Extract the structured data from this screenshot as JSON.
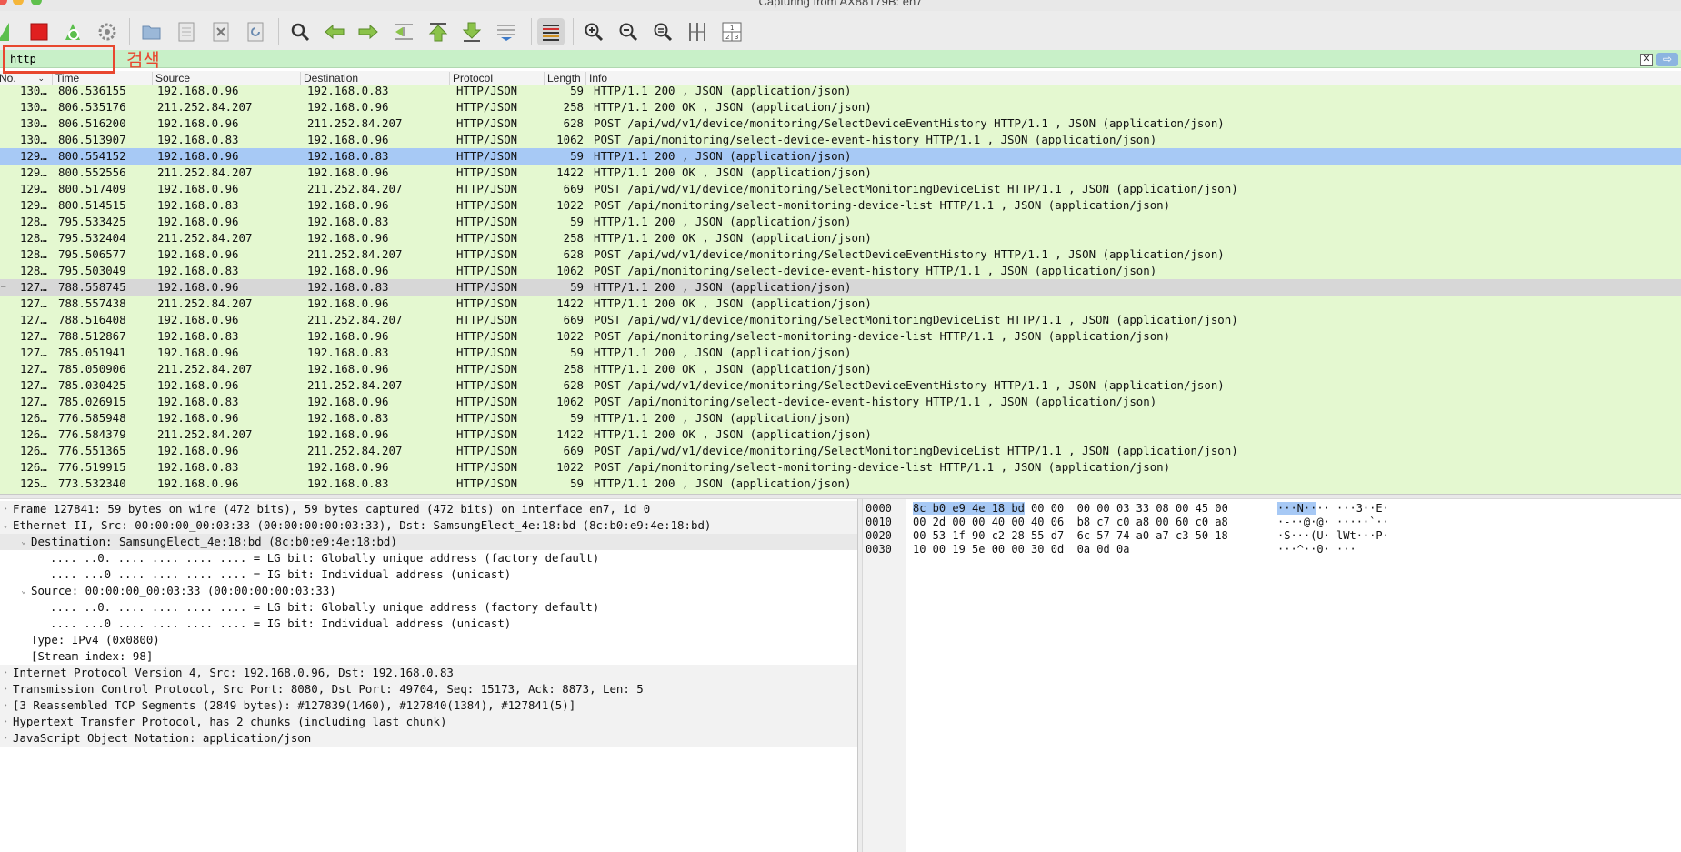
{
  "window": {
    "title": "Capturing from AX88179B: en7"
  },
  "filter": {
    "value": "http",
    "annotation": "검색"
  },
  "columns": [
    "No.",
    "Time",
    "Source",
    "Destination",
    "Protocol",
    "Length",
    "Info"
  ],
  "packets": [
    {
      "no": "130…",
      "time": "806.536155",
      "src": "192.168.0.96",
      "dst": "192.168.0.83",
      "proto": "HTTP/JSON",
      "len": "59",
      "info": "HTTP/1.1 200  , JSON (application/json)",
      "state": "normal"
    },
    {
      "no": "130…",
      "time": "806.535176",
      "src": "211.252.84.207",
      "dst": "192.168.0.96",
      "proto": "HTTP/JSON",
      "len": "258",
      "info": "HTTP/1.1 200 OK , JSON (application/json)",
      "state": "normal"
    },
    {
      "no": "130…",
      "time": "806.516200",
      "src": "192.168.0.96",
      "dst": "211.252.84.207",
      "proto": "HTTP/JSON",
      "len": "628",
      "info": "POST /api/wd/v1/device/monitoring/SelectDeviceEventHistory HTTP/1.1 , JSON (application/json)",
      "state": "normal"
    },
    {
      "no": "130…",
      "time": "806.513907",
      "src": "192.168.0.83",
      "dst": "192.168.0.96",
      "proto": "HTTP/JSON",
      "len": "1062",
      "info": "POST /api/monitoring/select-device-event-history HTTP/1.1 , JSON (application/json)",
      "state": "normal"
    },
    {
      "no": "129…",
      "time": "800.554152",
      "src": "192.168.0.96",
      "dst": "192.168.0.83",
      "proto": "HTTP/JSON",
      "len": "59",
      "info": "HTTP/1.1 200  , JSON (application/json)",
      "state": "selected"
    },
    {
      "no": "129…",
      "time": "800.552556",
      "src": "211.252.84.207",
      "dst": "192.168.0.96",
      "proto": "HTTP/JSON",
      "len": "1422",
      "info": "HTTP/1.1 200 OK , JSON (application/json)",
      "state": "normal"
    },
    {
      "no": "129…",
      "time": "800.517409",
      "src": "192.168.0.96",
      "dst": "211.252.84.207",
      "proto": "HTTP/JSON",
      "len": "669",
      "info": "POST /api/wd/v1/device/monitoring/SelectMonitoringDeviceList HTTP/1.1 , JSON (application/json)",
      "state": "normal"
    },
    {
      "no": "129…",
      "time": "800.514515",
      "src": "192.168.0.83",
      "dst": "192.168.0.96",
      "proto": "HTTP/JSON",
      "len": "1022",
      "info": "POST /api/monitoring/select-monitoring-device-list HTTP/1.1 , JSON (application/json)",
      "state": "normal"
    },
    {
      "no": "128…",
      "time": "795.533425",
      "src": "192.168.0.96",
      "dst": "192.168.0.83",
      "proto": "HTTP/JSON",
      "len": "59",
      "info": "HTTP/1.1 200  , JSON (application/json)",
      "state": "normal"
    },
    {
      "no": "128…",
      "time": "795.532404",
      "src": "211.252.84.207",
      "dst": "192.168.0.96",
      "proto": "HTTP/JSON",
      "len": "258",
      "info": "HTTP/1.1 200 OK , JSON (application/json)",
      "state": "normal"
    },
    {
      "no": "128…",
      "time": "795.506577",
      "src": "192.168.0.96",
      "dst": "211.252.84.207",
      "proto": "HTTP/JSON",
      "len": "628",
      "info": "POST /api/wd/v1/device/monitoring/SelectDeviceEventHistory HTTP/1.1 , JSON (application/json)",
      "state": "normal"
    },
    {
      "no": "128…",
      "time": "795.503049",
      "src": "192.168.0.83",
      "dst": "192.168.0.96",
      "proto": "HTTP/JSON",
      "len": "1062",
      "info": "POST /api/monitoring/select-device-event-history HTTP/1.1 , JSON (application/json)",
      "state": "normal"
    },
    {
      "no": "127…",
      "time": "788.558745",
      "src": "192.168.0.96",
      "dst": "192.168.0.83",
      "proto": "HTTP/JSON",
      "len": "59",
      "info": "HTTP/1.1 200  , JSON (application/json)",
      "state": "gray"
    },
    {
      "no": "127…",
      "time": "788.557438",
      "src": "211.252.84.207",
      "dst": "192.168.0.96",
      "proto": "HTTP/JSON",
      "len": "1422",
      "info": "HTTP/1.1 200 OK , JSON (application/json)",
      "state": "normal"
    },
    {
      "no": "127…",
      "time": "788.516408",
      "src": "192.168.0.96",
      "dst": "211.252.84.207",
      "proto": "HTTP/JSON",
      "len": "669",
      "info": "POST /api/wd/v1/device/monitoring/SelectMonitoringDeviceList HTTP/1.1 , JSON (application/json)",
      "state": "normal"
    },
    {
      "no": "127…",
      "time": "788.512867",
      "src": "192.168.0.83",
      "dst": "192.168.0.96",
      "proto": "HTTP/JSON",
      "len": "1022",
      "info": "POST /api/monitoring/select-monitoring-device-list HTTP/1.1 , JSON (application/json)",
      "state": "normal"
    },
    {
      "no": "127…",
      "time": "785.051941",
      "src": "192.168.0.96",
      "dst": "192.168.0.83",
      "proto": "HTTP/JSON",
      "len": "59",
      "info": "HTTP/1.1 200  , JSON (application/json)",
      "state": "normal"
    },
    {
      "no": "127…",
      "time": "785.050906",
      "src": "211.252.84.207",
      "dst": "192.168.0.96",
      "proto": "HTTP/JSON",
      "len": "258",
      "info": "HTTP/1.1 200 OK , JSON (application/json)",
      "state": "normal"
    },
    {
      "no": "127…",
      "time": "785.030425",
      "src": "192.168.0.96",
      "dst": "211.252.84.207",
      "proto": "HTTP/JSON",
      "len": "628",
      "info": "POST /api/wd/v1/device/monitoring/SelectDeviceEventHistory HTTP/1.1 , JSON (application/json)",
      "state": "normal"
    },
    {
      "no": "127…",
      "time": "785.026915",
      "src": "192.168.0.83",
      "dst": "192.168.0.96",
      "proto": "HTTP/JSON",
      "len": "1062",
      "info": "POST /api/monitoring/select-device-event-history HTTP/1.1 , JSON (application/json)",
      "state": "normal"
    },
    {
      "no": "126…",
      "time": "776.585948",
      "src": "192.168.0.96",
      "dst": "192.168.0.83",
      "proto": "HTTP/JSON",
      "len": "59",
      "info": "HTTP/1.1 200  , JSON (application/json)",
      "state": "normal"
    },
    {
      "no": "126…",
      "time": "776.584379",
      "src": "211.252.84.207",
      "dst": "192.168.0.96",
      "proto": "HTTP/JSON",
      "len": "1422",
      "info": "HTTP/1.1 200 OK , JSON (application/json)",
      "state": "normal"
    },
    {
      "no": "126…",
      "time": "776.551365",
      "src": "192.168.0.96",
      "dst": "211.252.84.207",
      "proto": "HTTP/JSON",
      "len": "669",
      "info": "POST /api/wd/v1/device/monitoring/SelectMonitoringDeviceList HTTP/1.1 , JSON (application/json)",
      "state": "normal"
    },
    {
      "no": "126…",
      "time": "776.519915",
      "src": "192.168.0.83",
      "dst": "192.168.0.96",
      "proto": "HTTP/JSON",
      "len": "1022",
      "info": "POST /api/monitoring/select-monitoring-device-list HTTP/1.1 , JSON (application/json)",
      "state": "normal"
    },
    {
      "no": "125…",
      "time": "773.532340",
      "src": "192.168.0.96",
      "dst": "192.168.0.83",
      "proto": "HTTP/JSON",
      "len": "59",
      "info": "HTTP/1.1 200  , JSON (application/json)",
      "state": "normal"
    }
  ],
  "details": [
    {
      "text": "Frame 127841: 59 bytes on wire (472 bits), 59 bytes captured (472 bits) on interface en7, id 0",
      "level": 0,
      "expander": "›",
      "style": "topl"
    },
    {
      "text": "Ethernet II, Src: 00:00:00_00:03:33 (00:00:00:00:03:33), Dst: SamsungElect_4e:18:bd (8c:b0:e9:4e:18:bd)",
      "level": 0,
      "expander": "⌄",
      "style": "topl"
    },
    {
      "text": "Destination: SamsungElect_4e:18:bd (8c:b0:e9:4e:18:bd)",
      "level": 1,
      "expander": "⌄",
      "style": "hl"
    },
    {
      "text": ".... ..0. .... .... .... .... = LG bit: Globally unique address (factory default)",
      "level": 2,
      "expander": "",
      "style": ""
    },
    {
      "text": ".... ...0 .... .... .... .... = IG bit: Individual address (unicast)",
      "level": 2,
      "expander": "",
      "style": ""
    },
    {
      "text": "Source: 00:00:00_00:03:33 (00:00:00:00:03:33)",
      "level": 1,
      "expander": "⌄",
      "style": ""
    },
    {
      "text": ".... ..0. .... .... .... .... = LG bit: Globally unique address (factory default)",
      "level": 2,
      "expander": "",
      "style": ""
    },
    {
      "text": ".... ...0 .... .... .... .... = IG bit: Individual address (unicast)",
      "level": 2,
      "expander": "",
      "style": ""
    },
    {
      "text": "Type: IPv4 (0x0800)",
      "level": 1,
      "expander": "",
      "style": ""
    },
    {
      "text": "[Stream index: 98]",
      "level": 1,
      "expander": "",
      "style": ""
    },
    {
      "text": "Internet Protocol Version 4, Src: 192.168.0.96, Dst: 192.168.0.83",
      "level": 0,
      "expander": "›",
      "style": "topl"
    },
    {
      "text": "Transmission Control Protocol, Src Port: 8080, Dst Port: 49704, Seq: 15173, Ack: 8873, Len: 5",
      "level": 0,
      "expander": "›",
      "style": "topl"
    },
    {
      "text": "[3 Reassembled TCP Segments (2849 bytes): #127839(1460), #127840(1384), #127841(5)]",
      "level": 0,
      "expander": "›",
      "style": "topl"
    },
    {
      "text": "Hypertext Transfer Protocol, has 2 chunks (including last chunk)",
      "level": 0,
      "expander": "›",
      "style": "topl"
    },
    {
      "text": "JavaScript Object Notation: application/json",
      "level": 0,
      "expander": "›",
      "style": "topl"
    }
  ],
  "bytes": [
    {
      "offset": "0000",
      "hex_sel": "8c b0 e9 4e 18 bd",
      "hex_rest": " 00 00  00 00 03 33 08 00 45 00",
      "ascii_sel": "···N··",
      "ascii_rest": "·· ···3··E·"
    },
    {
      "offset": "0010",
      "hex_sel": "",
      "hex_rest": "00 2d 00 00 40 00 40 06  b8 c7 c0 a8 00 60 c0 a8",
      "ascii_sel": "",
      "ascii_rest": "·-··@·@· ·····`··"
    },
    {
      "offset": "0020",
      "hex_sel": "",
      "hex_rest": "00 53 1f 90 c2 28 55 d7  6c 57 74 a0 a7 c3 50 18",
      "ascii_sel": "",
      "ascii_rest": "·S···(U· lWt···P·"
    },
    {
      "offset": "0030",
      "hex_sel": "",
      "hex_rest": "10 00 19 5e 00 00 30 0d  0a 0d 0a",
      "ascii_sel": "",
      "ascii_rest": "···^··0· ···"
    }
  ],
  "toolbar": {
    "icons": [
      "shark-fin-start-icon",
      "stop-capture-icon",
      "restart-capture-icon",
      "capture-options-icon",
      "open-file-icon",
      "save-file-icon",
      "close-file-icon",
      "reload-file-icon",
      "find-packet-icon",
      "go-back-icon",
      "go-forward-icon",
      "go-to-packet-icon",
      "first-packet-icon",
      "last-packet-icon",
      "auto-scroll-icon",
      "colorize-icon",
      "zoom-in-icon",
      "zoom-out-icon",
      "normal-size-icon",
      "resize-columns-icon",
      "layout-icon"
    ]
  },
  "colors": {
    "accent_red": "#e8472f",
    "row_green": "#e4f8d0",
    "row_selected": "#a7c9f5",
    "filter_bg": "#c8f0c8"
  }
}
